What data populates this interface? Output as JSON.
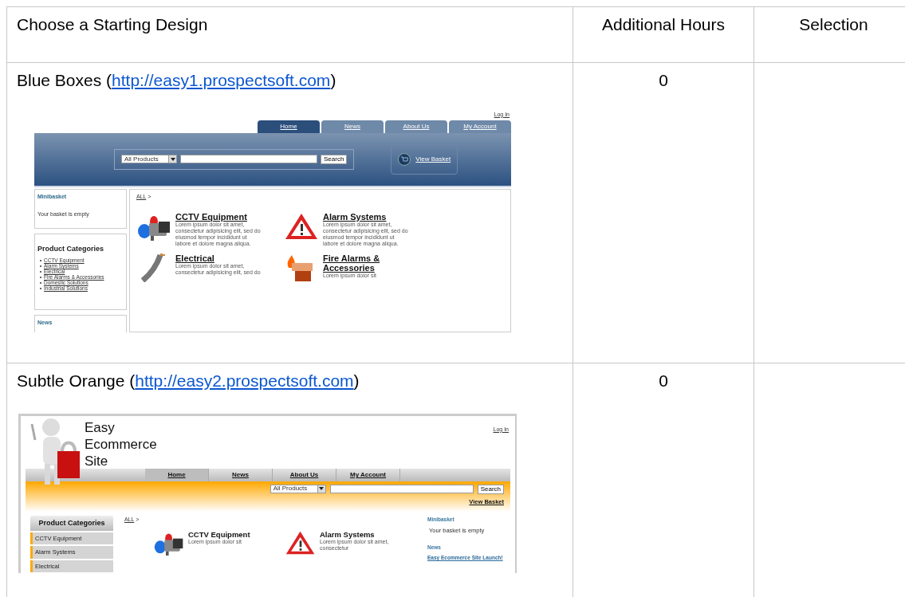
{
  "table": {
    "columns": [
      "Choose a Starting Design",
      "Additional Hours",
      "Selection"
    ],
    "rows": [
      {
        "title_prefix": "Blue Boxes (",
        "link": "http://easy1.prospectsoft.com",
        "title_suffix": ")",
        "hours": "0",
        "preview": {
          "kind": "blue",
          "login": "Log In",
          "tabs": [
            {
              "label": "Home",
              "selected": true
            },
            {
              "label": "News",
              "selected": false
            },
            {
              "label": "About Us",
              "selected": false
            },
            {
              "label": "My Account",
              "selected": false
            }
          ],
          "search": {
            "select": "All Products",
            "button": "Search"
          },
          "basket": "View Basket",
          "minibasket": {
            "title": "Minibasket",
            "text": "Your basket is empty"
          },
          "categories": {
            "title": "Product Categories",
            "items": [
              "CCTV Equipment",
              "Alarm Systems",
              "Electrical",
              "Fire Alarms & Accessories",
              "Domestic Solutions",
              "Industrial Solutions"
            ]
          },
          "news": {
            "title": "News"
          },
          "breadcrumb": {
            "link": "ALL",
            "separator": ">"
          },
          "products": [
            {
              "kind": "camera",
              "title": "CCTV Equipment",
              "text": "Lorem ipsum dolor sit amet, consectetur adipisicing elit, sed do eiusmod tempor incididunt ut labore et dolore magna aliqua."
            },
            {
              "kind": "warning",
              "title": "Alarm Systems",
              "text": "Lorem ipsum dolor sit amet, consectetur adipisicing elit, sed do eiusmod tempor incididunt ut labore et dolore magna aliqua."
            },
            {
              "kind": "cable",
              "title": "Electrical",
              "text": "Lorem ipsum dolor sit amet, consectetur adipisicing elit, sed do"
            },
            {
              "kind": "fire",
              "title": "Fire Alarms & Accessories",
              "text": "Lorem ipsum dolor sit"
            }
          ]
        }
      },
      {
        "title_prefix": "Subtle Orange (",
        "link": "http://easy2.prospectsoft.com",
        "title_suffix": ")",
        "hours": "0",
        "preview": {
          "kind": "orange",
          "logo": "Easy Ecommerce Site",
          "login": "Log In",
          "tabs": [
            {
              "label": "Home",
              "selected": true
            },
            {
              "label": "News",
              "selected": false
            },
            {
              "label": "About Us",
              "selected": false
            },
            {
              "label": "My Account",
              "selected": false
            }
          ],
          "search": {
            "select": "All Products",
            "button": "Search"
          },
          "basket": "View Basket",
          "minibasket": {
            "title": "Minibasket",
            "text": "Your basket is empty"
          },
          "categories": {
            "title": "Product Categories",
            "items": [
              "CCTV Equipment",
              "Alarm Systems",
              "Electrical"
            ]
          },
          "news": {
            "title": "News",
            "items": [
              "Easy Ecommerce Site Launch!"
            ]
          },
          "breadcrumb": {
            "link": "ALL",
            "separator": ">"
          },
          "products": [
            {
              "kind": "camera",
              "title": "CCTV Equipment",
              "text": "Lorem ipsum dolor sit"
            },
            {
              "kind": "warning",
              "title": "Alarm Systems",
              "text": "Lorem ipsum dolor sit amet, consectetur"
            }
          ]
        }
      }
    ]
  }
}
